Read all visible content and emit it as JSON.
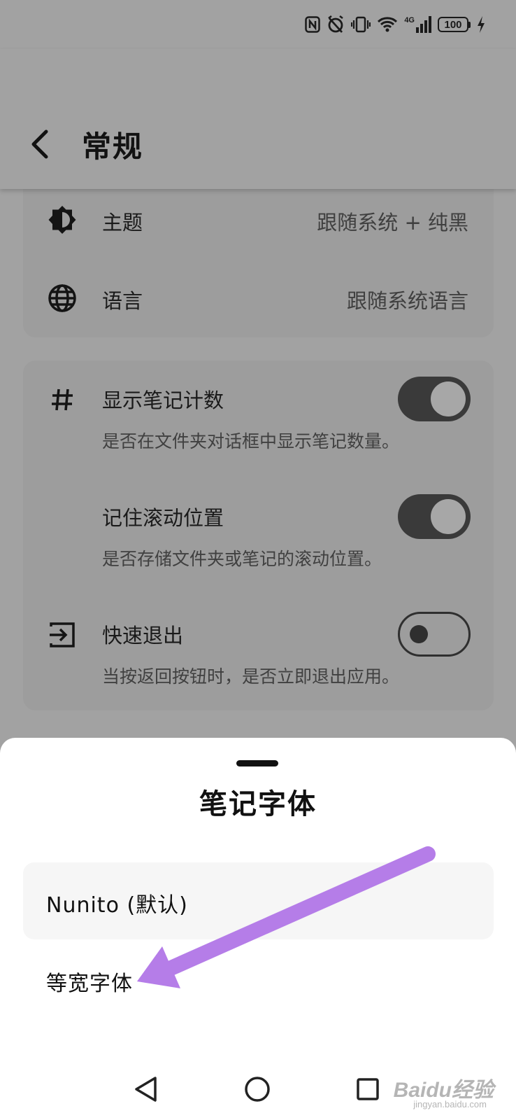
{
  "status_bar": {
    "network": "4G",
    "battery": "100"
  },
  "header": {
    "title": "常规"
  },
  "settings": {
    "theme": {
      "label": "主题",
      "value": "跟随系统 + 纯黑"
    },
    "language": {
      "label": "语言",
      "value": "跟随系统语言"
    },
    "show_note_count": {
      "label": "显示笔记计数",
      "description": "是否在文件夹对话框中显示笔记数量。",
      "enabled": true
    },
    "remember_scroll": {
      "label": "记住滚动位置",
      "description": "是否存储文件夹或笔记的滚动位置。",
      "enabled": true
    },
    "quick_exit": {
      "label": "快速退出",
      "description": "当按返回按钮时，是否立即退出应用。",
      "enabled": false
    }
  },
  "sheet": {
    "title": "笔记字体",
    "options": [
      {
        "label": "Nunito (默认)",
        "selected": true
      },
      {
        "label": "等宽字体",
        "selected": false
      }
    ]
  },
  "annotation": {
    "color": "#b57de8"
  },
  "watermark": {
    "main": "Baidu经验",
    "sub": "jingyan.baidu.com"
  }
}
